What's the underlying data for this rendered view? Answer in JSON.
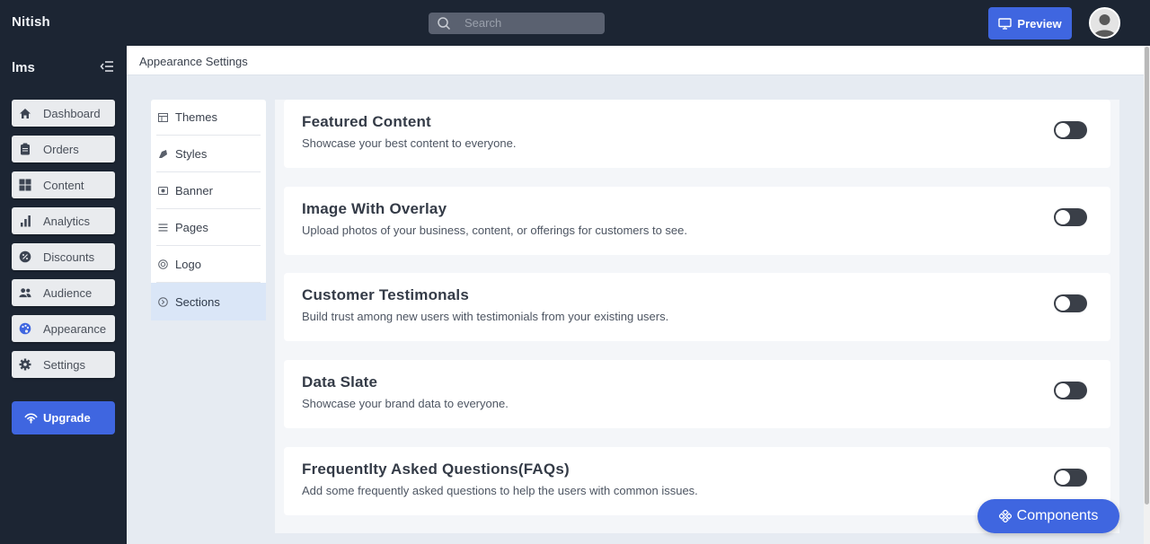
{
  "topbar": {
    "brand": "Nitish",
    "search_placeholder": "Search",
    "preview_label": "Preview"
  },
  "sidebar": {
    "workspace": "lms",
    "items": [
      {
        "label": "Dashboard",
        "icon": "home-icon"
      },
      {
        "label": "Orders",
        "icon": "clipboard-icon"
      },
      {
        "label": "Content",
        "icon": "grid-icon"
      },
      {
        "label": "Analytics",
        "icon": "bar-chart-icon"
      },
      {
        "label": "Discounts",
        "icon": "discount-icon"
      },
      {
        "label": "Audience",
        "icon": "users-icon"
      },
      {
        "label": "Appearance",
        "icon": "palette-icon"
      },
      {
        "label": "Settings",
        "icon": "gear-icon"
      }
    ],
    "upgrade_label": "Upgrade"
  },
  "breadcrumb": "Appearance Settings",
  "subnav": {
    "items": [
      {
        "label": "Themes",
        "icon": "themes-icon"
      },
      {
        "label": "Styles",
        "icon": "styles-icon"
      },
      {
        "label": "Banner",
        "icon": "banner-icon"
      },
      {
        "label": "Pages",
        "icon": "pages-icon"
      },
      {
        "label": "Logo",
        "icon": "logo-icon"
      },
      {
        "label": "Sections",
        "icon": "sections-icon"
      }
    ],
    "active": "Sections"
  },
  "sections": [
    {
      "title": "Featured Content",
      "description": "Showcase your best content to everyone.",
      "enabled": false
    },
    {
      "title": "Image With Overlay",
      "description": "Upload photos of your business, content, or offerings for customers to see.",
      "enabled": false
    },
    {
      "title": "Customer Testimonals",
      "description": "Build trust among new users with testimonials from your existing users.",
      "enabled": false
    },
    {
      "title": "Data Slate",
      "description": "Showcase your brand data to everyone.",
      "enabled": false
    },
    {
      "title": "Frequentlty Asked Questions(FAQs)",
      "description": "Add some frequently asked questions to help the users with common issues.",
      "enabled": false
    }
  ],
  "components_label": "Components",
  "colors": {
    "sidebar_bg": "#1c2533",
    "accent": "#3f66e0",
    "active_subnav": "#dae6f7",
    "toggle_off": "#3a3f48"
  }
}
